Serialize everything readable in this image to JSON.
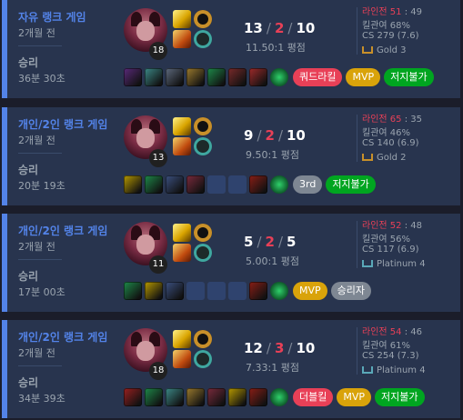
{
  "games": [
    {
      "queue_type": "자유 랭크 게임",
      "time_ago": "2개월 전",
      "result": "승리",
      "duration": "36분 30초",
      "champion_level": "18",
      "kda": {
        "kills": "13",
        "deaths": "2",
        "assists": "10",
        "sep": "/"
      },
      "ratio": "11.50:1 평점",
      "lane": {
        "label": "라인전",
        "left": "51",
        "right": "49",
        "sep": ":"
      },
      "kill_participation": "킬관여 68%",
      "cs": "CS 279 (7.6)",
      "tier": "Gold 3",
      "tier_style": "gold",
      "items": [
        "dark-seal",
        "stopwatch",
        "bookshelf-item",
        "wand-item",
        "boots-item",
        "hand-item",
        "tome-item"
      ],
      "ward": "oracle-lens",
      "badges": [
        {
          "text": "쿼드라킬",
          "color": "red"
        },
        {
          "text": "MVP",
          "color": "mvp"
        },
        {
          "text": "저지불가",
          "color": "green"
        }
      ]
    },
    {
      "queue_type": "개인/2인 랭크 게임",
      "time_ago": "2개월 전",
      "result": "승리",
      "duration": "20분 19초",
      "champion_level": "13",
      "kda": {
        "kills": "9",
        "deaths": "2",
        "assists": "10",
        "sep": "/"
      },
      "ratio": "9.50:1 평점",
      "lane": {
        "label": "라인전",
        "left": "65",
        "right": "35",
        "sep": ":"
      },
      "kill_participation": "킬관여 46%",
      "cs": "CS 140 (6.9)",
      "tier": "Gold 2",
      "tier_style": "gold",
      "items": [
        "triangle-item",
        "boots-item",
        "book-item",
        "scythe-item",
        "empty",
        "empty",
        "torch-item"
      ],
      "ward": "oracle-lens",
      "badges": [
        {
          "text": "3rd",
          "color": "3rd"
        },
        {
          "text": "저지불가",
          "color": "green"
        }
      ]
    },
    {
      "queue_type": "개인/2인 랭크 게임",
      "time_ago": "2개월 전",
      "result": "승리",
      "duration": "17분 00초",
      "champion_level": "11",
      "kda": {
        "kills": "5",
        "deaths": "2",
        "assists": "5",
        "sep": "/"
      },
      "ratio": "5.00:1 평점",
      "lane": {
        "label": "라인전",
        "left": "52",
        "right": "48",
        "sep": ":"
      },
      "kill_participation": "킬관여 56%",
      "cs": "CS 117 (6.9)",
      "tier": "Platinum 4",
      "tier_style": "plat",
      "items": [
        "boots-item",
        "triangle-item",
        "book-item",
        "empty",
        "empty",
        "empty",
        "torch-item"
      ],
      "ward": "oracle-lens",
      "badges": [
        {
          "text": "MVP",
          "color": "mvp"
        },
        {
          "text": "승리자",
          "color": "win"
        }
      ]
    },
    {
      "queue_type": "개인/2인 랭크 게임",
      "time_ago": "2개월 전",
      "result": "승리",
      "duration": "34분 39초",
      "champion_level": "18",
      "kda": {
        "kills": "12",
        "deaths": "3",
        "assists": "10",
        "sep": "/"
      },
      "ratio": "7.33:1 평점",
      "lane": {
        "label": "라인전",
        "left": "54",
        "right": "46",
        "sep": ":"
      },
      "kill_participation": "킬관여 61%",
      "cs": "CS 254 (7.3)",
      "tier": "Platinum 4",
      "tier_style": "plat",
      "items": [
        "gauntlet-item",
        "boots-item",
        "stopwatch",
        "wand-item",
        "scythe-item",
        "triangle-item",
        "torch-item"
      ],
      "ward": "oracle-lens",
      "badges": [
        {
          "text": "더블킬",
          "color": "red"
        },
        {
          "text": "MVP",
          "color": "mvp"
        },
        {
          "text": "저지불가",
          "color": "green"
        }
      ]
    }
  ],
  "item_colors": {
    "dark-seal": "#5a2a7a",
    "stopwatch": "#3c8a88",
    "bookshelf-item": "#5e6a7e",
    "wand-item": "#9c7b2e",
    "boots-item": "#1e8a4a",
    "hand-item": "#7a2a2a",
    "tome-item": "#a02a2a",
    "triangle-item": "#b89a00",
    "book-item": "#3b5080",
    "scythe-item": "#7a2a3c",
    "torch-item": "#8a1e16",
    "gauntlet-item": "#9a2020",
    "oracle-lens": "#0e8a3a"
  }
}
